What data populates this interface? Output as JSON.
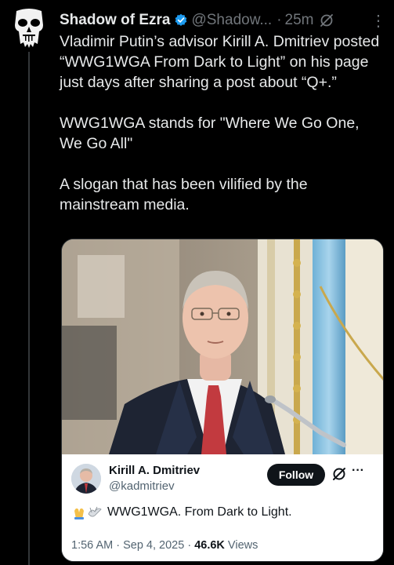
{
  "post": {
    "author_name": "Shadow of Ezra",
    "handle": "@Shadow...",
    "dot": "·",
    "time": "25m",
    "more": "⋮",
    "paragraphs": [
      "Vladimir Putin’s advisor Kirill A. Dmitriev posted “WWG1WGA From Dark to Light” on his page just days after sharing a post about “Q+.”",
      "WWG1WGA stands for \"Where We Go One, We Go All\"",
      "A slogan that has been vilified by the mainstream media."
    ]
  },
  "quote": {
    "name": "Kirill A. Dmitriev",
    "handle": "@kadmitriev",
    "follow_label": "Follow",
    "more": "···",
    "text": "WWG1WGA. From Dark to Light.",
    "time": "1:56 AM",
    "sep1": " · ",
    "date": "Sep 4, 2025",
    "sep2": " · ",
    "views_count": "46.6K",
    "views_label": " Views"
  },
  "colors": {
    "background": "#000000",
    "text": "#e7e9ea",
    "muted": "#71767b",
    "verified": "#1d9bf0",
    "follow_bg": "#0f1419"
  },
  "icons": {
    "avatar": "punisher-skull-icon",
    "verified": "verified-badge-icon",
    "grok": "grok-icon",
    "more": "more-vertical-icon",
    "quote_more": "more-horizontal-icon",
    "emoji": "praying-hands-dove-icon"
  }
}
